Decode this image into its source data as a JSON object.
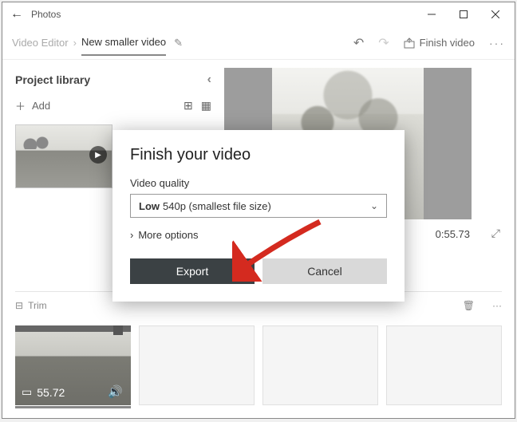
{
  "titlebar": {
    "app_name": "Photos"
  },
  "toolbar": {
    "crumb1": "Video Editor",
    "crumb2": "New smaller video",
    "finish_label": "Finish video"
  },
  "library": {
    "heading": "Project library",
    "add_label": "Add"
  },
  "preview": {
    "timecode": "0:55.73"
  },
  "bottombar": {
    "trim_label": "Trim"
  },
  "storyboard": {
    "clip_duration": "55.72"
  },
  "modal": {
    "title": "Finish your video",
    "quality_label": "Video quality",
    "quality_value_bold": "Low",
    "quality_value_rest": "540p (smallest file size)",
    "more_options": "More options",
    "export_label": "Export",
    "cancel_label": "Cancel"
  }
}
